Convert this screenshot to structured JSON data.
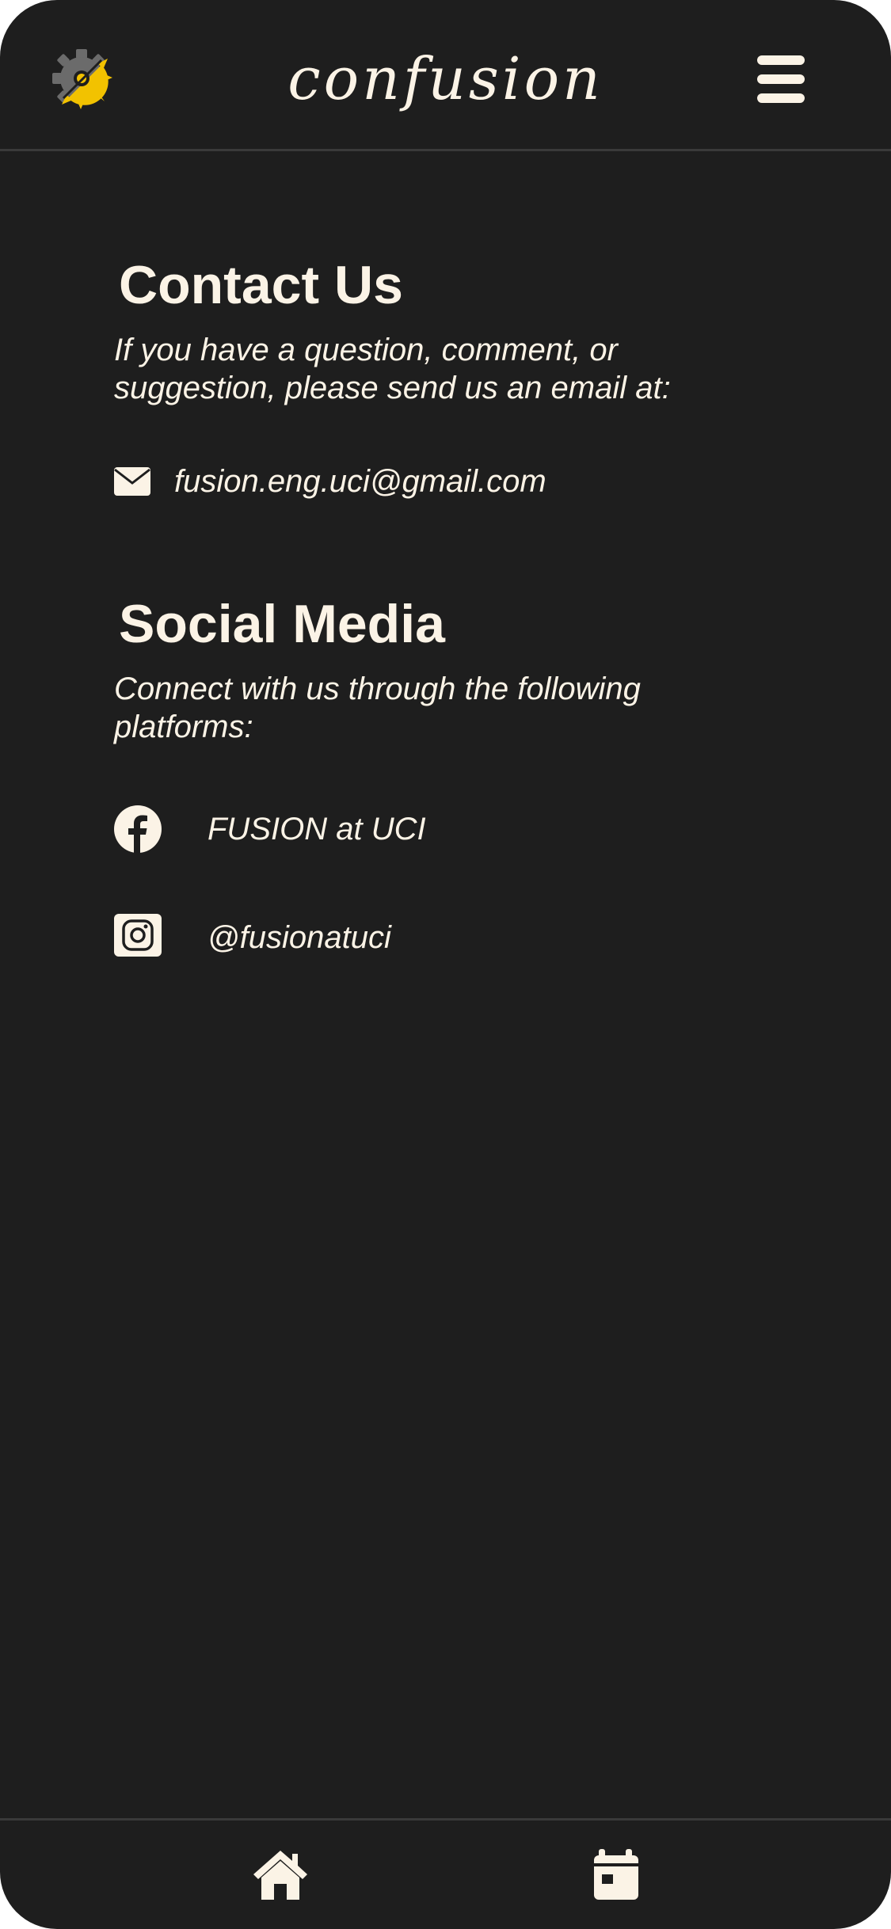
{
  "header": {
    "brand": "confusion",
    "logo_icon": "gear-sun-logo-icon",
    "menu_icon": "hamburger-menu-icon"
  },
  "contact": {
    "title": "Contact Us",
    "description": "If you have a question, comment, or suggestion, please send us an email at:",
    "email_icon": "envelope-icon",
    "email": "fusion.eng.uci@gmail.com"
  },
  "social": {
    "title": "Social Media",
    "description": "Connect with us through the following platforms:",
    "items": [
      {
        "icon": "facebook-icon",
        "label": "FUSION at UCI"
      },
      {
        "icon": "instagram-icon",
        "label": "@fusionatuci"
      }
    ]
  },
  "bottom_nav": {
    "items": [
      {
        "icon": "home-icon"
      },
      {
        "icon": "calendar-icon"
      }
    ]
  },
  "colors": {
    "background": "#1e1e1e",
    "text": "#fbf3e6",
    "divider": "#3a3a3a",
    "logo_gear": "#6b6b6b",
    "logo_sun": "#f2c200"
  }
}
